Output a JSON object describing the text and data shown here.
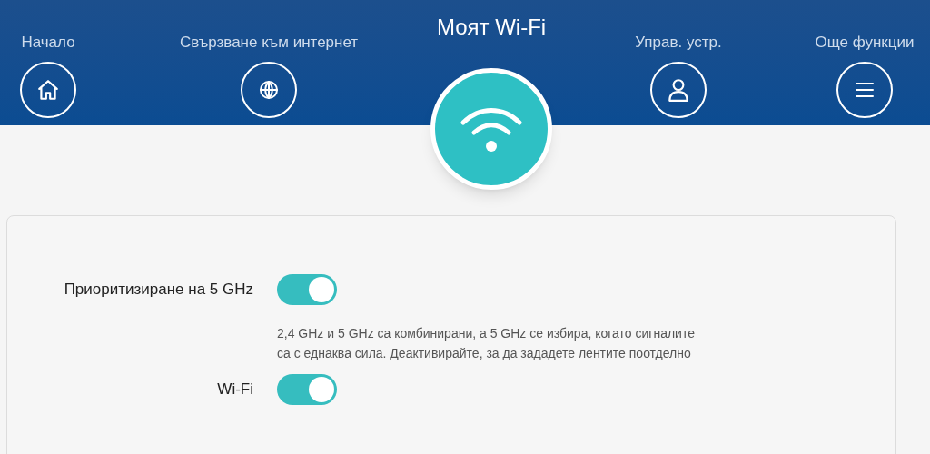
{
  "nav": [
    {
      "label": "Начало",
      "kind": "home",
      "selected": false
    },
    {
      "label": "Свързване към интернет",
      "kind": "globe",
      "selected": false
    },
    {
      "label": "Моят Wi-Fi",
      "kind": "wifi",
      "selected": true
    },
    {
      "label": "Управ. устр.",
      "kind": "user",
      "selected": false
    },
    {
      "label": "Още функции",
      "kind": "menu",
      "selected": false
    }
  ],
  "settings": [
    {
      "label": "Приоритизиране на 5 GHz",
      "on": true,
      "description": "2,4 GHz и 5 GHz са комбинирани, а 5 GHz се избира, когато сигналите са с еднаква сила. Деактивирайте, за да зададете лентите поотделно"
    },
    {
      "label": "Wi-Fi",
      "on": true
    }
  ]
}
